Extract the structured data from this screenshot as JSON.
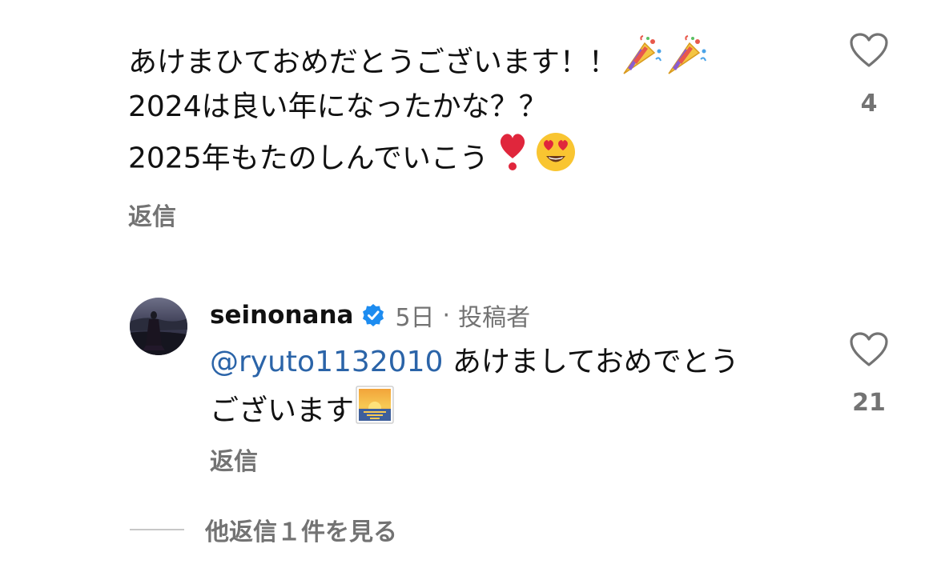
{
  "comment_1": {
    "lines": [
      "あけまひておめだとうございます！！",
      "2024は良い年になったかな？？",
      "2025年もたのしんでいこう"
    ],
    "line1_emojis": [
      "party-popper",
      "party-popper"
    ],
    "line3_emojis": [
      "heart-exclamation",
      "heart-eyes-face"
    ],
    "reply_label": "返信",
    "like_count": "4"
  },
  "reply_comment": {
    "username": "seinonana",
    "verified": true,
    "time": "5日",
    "separator": "·",
    "author_tag": "投稿者",
    "mention": "@ryuto1132010",
    "text_part1": " あけましておめでとう",
    "text_part2": "ございます",
    "text_emoji": "sunrise",
    "reply_label": "返信",
    "like_count": "21"
  },
  "view_more_replies": "他返信１件を見る",
  "colors": {
    "primary_text": "#111111",
    "secondary_text": "#737373",
    "mention": "#2b64a8",
    "verified_badge": "#1d8cf0"
  }
}
